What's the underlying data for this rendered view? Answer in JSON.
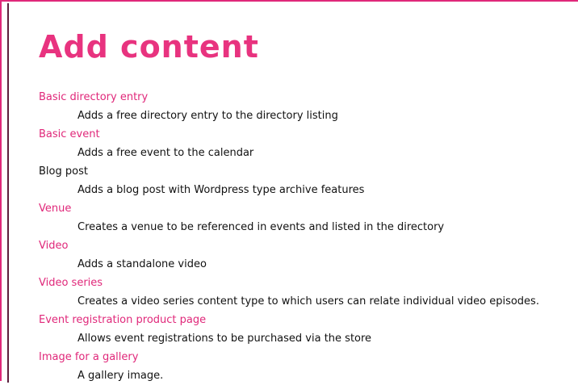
{
  "page": {
    "title": "Add content"
  },
  "items": [
    {
      "label": "Basic directory entry",
      "description": "Adds a free directory entry to the directory listing",
      "linked": true
    },
    {
      "label": "Basic event",
      "description": "Adds a free event to the calendar",
      "linked": true
    },
    {
      "label": "Blog post",
      "description": "Adds a blog post with Wordpress type archive features",
      "linked": false
    },
    {
      "label": "Venue",
      "description": "Creates a venue to be referenced in events and listed in the directory",
      "linked": true
    },
    {
      "label": "Video",
      "description": "Adds a standalone video",
      "linked": true
    },
    {
      "label": "Video series",
      "description": "Creates a video series content type to which users can relate individual video episodes.",
      "linked": true
    },
    {
      "label": "Event registration product page",
      "description": "Allows event registrations to be purchased via the store",
      "linked": true
    },
    {
      "label": "Image for a gallery",
      "description": "A gallery image.",
      "linked": true
    }
  ],
  "colors": {
    "accent": "#e0287a",
    "title": "#e8337f",
    "text": "#111111",
    "frame_dark": "#5b1f3c"
  }
}
